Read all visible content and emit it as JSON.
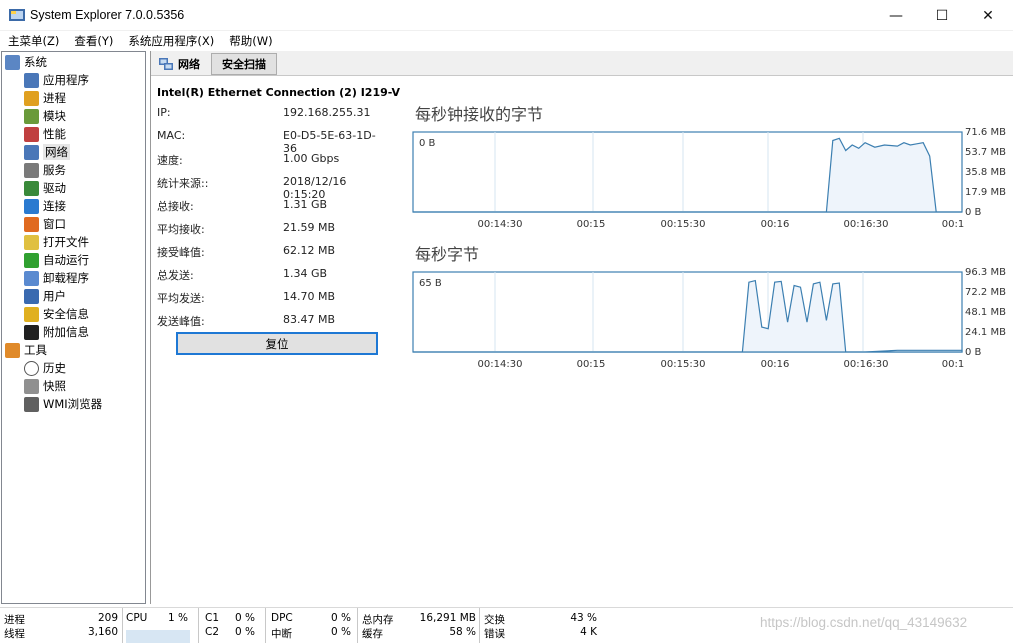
{
  "window": {
    "title": "System Explorer 7.0.0.5356",
    "minimize_glyph": "—",
    "maximize_glyph": "☐",
    "close_glyph": "✕"
  },
  "menu": [
    "主菜单(Z)",
    "查看(Y)",
    "系统应用程序(X)",
    "帮助(W)"
  ],
  "tree": {
    "system_label": "系统",
    "system_items": [
      "应用程序",
      "进程",
      "模块",
      "性能",
      "网络",
      "服务",
      "驱动",
      "连接",
      "窗口",
      "打开文件",
      "自动运行",
      "卸载程序",
      "用户",
      "安全信息",
      "附加信息"
    ],
    "tools_label": "工具",
    "tools_items": [
      "历史",
      "快照",
      "WMI浏览器"
    ],
    "selected": "网络"
  },
  "tabs": {
    "network": "网络",
    "security_scan": "安全扫描"
  },
  "adapter": {
    "name": "Intel(R) Ethernet Connection (2) I219-V",
    "rows": [
      {
        "k": "IP:",
        "v": "192.168.255.31"
      },
      {
        "k": "MAC:",
        "v": "E0-D5-5E-63-1D-36"
      },
      {
        "k": "速度:",
        "v": "1.00 Gbps"
      },
      {
        "k": "统计来源::",
        "v": "2018/12/16 0:15:20"
      },
      {
        "k": "总接收:",
        "v": "1.31 GB"
      },
      {
        "k": "平均接收:",
        "v": "21.59 MB"
      },
      {
        "k": "接受峰值:",
        "v": "62.12 MB"
      },
      {
        "k": "总发送:",
        "v": "1.34 GB"
      },
      {
        "k": "平均发送:",
        "v": "14.70 MB"
      },
      {
        "k": "发送峰值:",
        "v": "83.47 MB"
      }
    ],
    "reset_label": "复位"
  },
  "chart_data": [
    {
      "type": "area",
      "title": "每秒钟接收的字节",
      "current_label": "0 B",
      "y_ticks": [
        "71.6 MB",
        "53.7 MB",
        "35.8 MB",
        "17.9 MB",
        "0 B"
      ],
      "x_ticks": [
        "00:14:30",
        "00:15",
        "00:15:30",
        "00:16",
        "00:16:30",
        "00:1"
      ],
      "series": [
        {
          "x_seconds": [
            0,
            60,
            120,
            128,
            130,
            132,
            134,
            136,
            138,
            140,
            143,
            146,
            150,
            152,
            154,
            156,
            158,
            160,
            162,
            170
          ],
          "values": [
            0,
            0,
            0,
            0,
            64,
            66,
            55,
            60,
            57,
            62,
            58,
            60,
            59,
            62,
            60,
            61,
            62,
            50,
            0,
            0
          ]
        }
      ]
    },
    {
      "type": "area",
      "title": "每秒字节",
      "current_label": "65 B",
      "y_ticks": [
        "96.3 MB",
        "72.2 MB",
        "48.1 MB",
        "24.1 MB",
        "0 B"
      ],
      "x_ticks": [
        "00:14:30",
        "00:15",
        "00:15:30",
        "00:16",
        "00:16:30",
        "00:1"
      ],
      "series": [
        {
          "x_seconds": [
            0,
            60,
            100,
            102,
            104,
            106,
            108,
            110,
            112,
            114,
            116,
            118,
            120,
            122,
            124,
            126,
            128,
            130,
            132,
            134,
            136,
            140,
            150,
            170
          ],
          "values": [
            0,
            0,
            0,
            0,
            84,
            86,
            30,
            28,
            84,
            85,
            36,
            80,
            78,
            36,
            82,
            84,
            38,
            82,
            83,
            0,
            0,
            0,
            2,
            2
          ]
        }
      ]
    }
  ],
  "status": {
    "processes_label": "进程",
    "processes": "209",
    "threads_label": "线程",
    "threads": "3,160",
    "cpu_label": "CPU",
    "cpu": "1 %",
    "c1_label": "C1",
    "c1": "0 %",
    "c2_label": "C2",
    "c2": "0 %",
    "dpc_label": "DPC",
    "dpc": "0 %",
    "int_label": "中断",
    "int": "0 %",
    "mem_label": "总内存",
    "mem": "16,291 MB",
    "cache_label": "缓存",
    "cache": "58 %",
    "swap_label": "交换",
    "swap": "43 %",
    "err_label": "错误",
    "err": "4 K"
  },
  "watermark": "https://blog.csdn.net/qq_43149632"
}
